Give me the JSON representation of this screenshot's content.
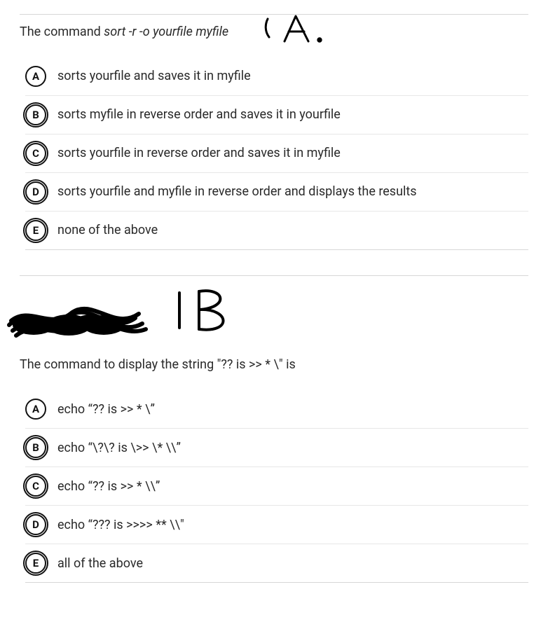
{
  "q1": {
    "prompt_prefix": "The command ",
    "prompt_cmd": "sort -r -o yourfile myfile",
    "annotation": "I A.",
    "options": [
      {
        "letter": "A",
        "text": "sorts yourfile and saves it in myfile",
        "dbl": false
      },
      {
        "letter": "B",
        "text": "sorts myfile in reverse order and saves it in yourfile",
        "dbl": true
      },
      {
        "letter": "C",
        "text": "sorts yourfile in reverse order and saves it in myfile",
        "dbl": true
      },
      {
        "letter": "D",
        "text": "sorts yourfile and myfile in reverse order and displays the results",
        "dbl": true
      },
      {
        "letter": "E",
        "text": "none of the above",
        "dbl": true
      }
    ]
  },
  "scribble_annotation": "IB",
  "q2": {
    "prompt_prefix": "The command to display the string ",
    "prompt_quote": "\"?? is >> * \\\" is",
    "options": [
      {
        "letter": "A",
        "text": "echo “?? is >> * \\”",
        "dbl": false
      },
      {
        "letter": "B",
        "text": "echo “\\?\\? is \\>> \\* \\\\”",
        "dbl": true
      },
      {
        "letter": "C",
        "text": "echo “?? is >> * \\\\”",
        "dbl": true
      },
      {
        "letter": "D",
        "text": "echo “??? is >>>> ** \\\\\"",
        "dbl": true
      },
      {
        "letter": "E",
        "text": "all of the above",
        "dbl": true
      }
    ]
  }
}
